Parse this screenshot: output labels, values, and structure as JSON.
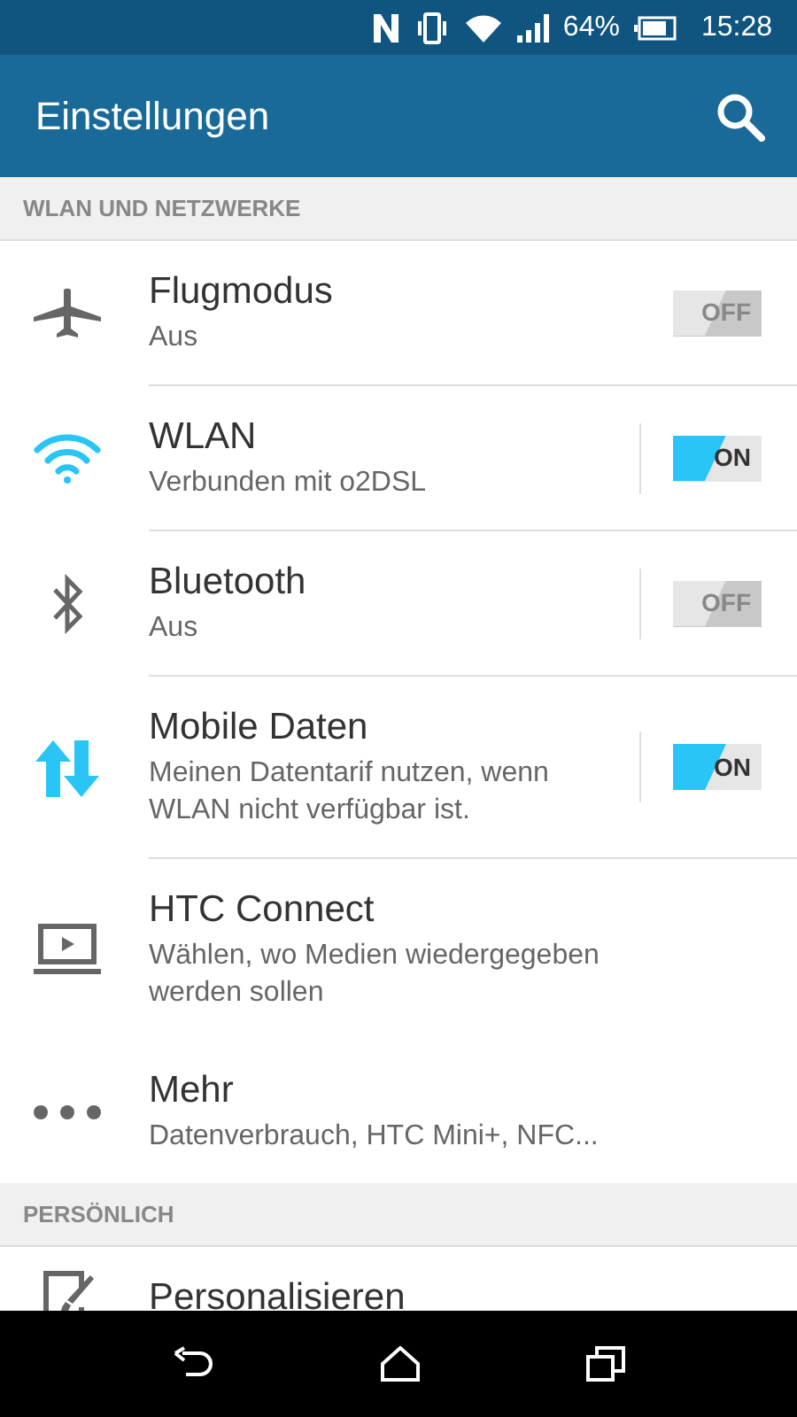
{
  "status_bar": {
    "battery": "64%",
    "time": "15:28"
  },
  "app_bar": {
    "title": "Einstellungen"
  },
  "sections": [
    {
      "title": "WLAN UND NETZWERKE",
      "items": [
        {
          "kind": "toggle",
          "title": "Flugmodus",
          "subtitle": "Aus",
          "on": false,
          "split": false,
          "toggle_label": "OFF"
        },
        {
          "kind": "toggle",
          "title": "WLAN",
          "subtitle": "Verbunden mit o2DSL",
          "on": true,
          "split": true,
          "toggle_label": "ON"
        },
        {
          "kind": "toggle",
          "title": "Bluetooth",
          "subtitle": "Aus",
          "on": false,
          "split": true,
          "toggle_label": "OFF"
        },
        {
          "kind": "toggle",
          "title": "Mobile Daten",
          "subtitle": "Meinen Datentarif nutzen, wenn WLAN nicht verfügbar ist.",
          "on": true,
          "split": true,
          "toggle_label": "ON"
        },
        {
          "kind": "link",
          "title": "HTC Connect",
          "subtitle": "Wählen, wo Medien wiedergegeben werden sollen"
        },
        {
          "kind": "link",
          "title": "Mehr",
          "subtitle": "Datenverbrauch, HTC Mini+, NFC..."
        }
      ]
    },
    {
      "title": "PERSÖNLICH",
      "items": [
        {
          "kind": "link",
          "title": "Personalisieren"
        }
      ]
    }
  ]
}
